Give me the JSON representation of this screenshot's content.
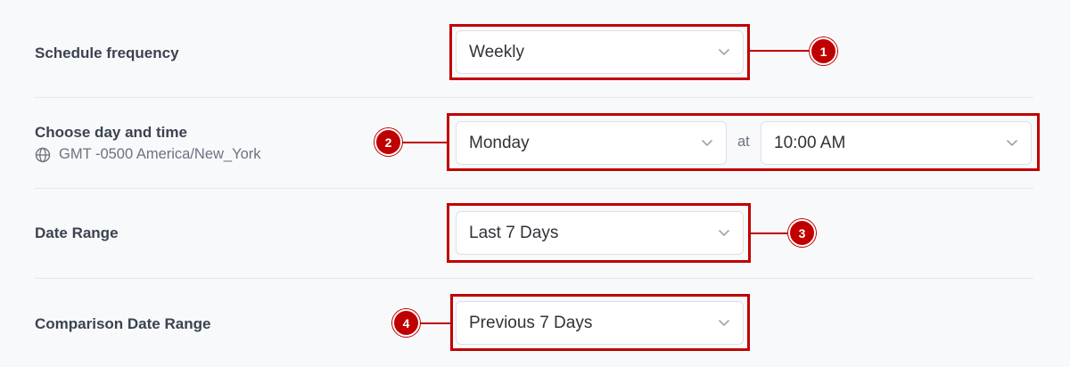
{
  "schedule": {
    "frequency_label": "Schedule frequency",
    "frequency_value": "Weekly"
  },
  "day_time": {
    "label": "Choose day and time",
    "timezone": "GMT -0500 America/New_York",
    "day_value": "Monday",
    "connector": "at",
    "time_value": "10:00 AM"
  },
  "date_range": {
    "label": "Date Range",
    "value": "Last 7 Days"
  },
  "comparison": {
    "label": "Comparison Date Range",
    "value": "Previous 7 Days"
  },
  "callouts": [
    "1",
    "2",
    "3",
    "4"
  ],
  "colors": {
    "callout": "#c00000",
    "background": "#f8f9fa",
    "select_border": "#dcdfe4"
  },
  "icons": {
    "timezone": "globe-icon",
    "dropdown": "chevron-down-icon"
  }
}
